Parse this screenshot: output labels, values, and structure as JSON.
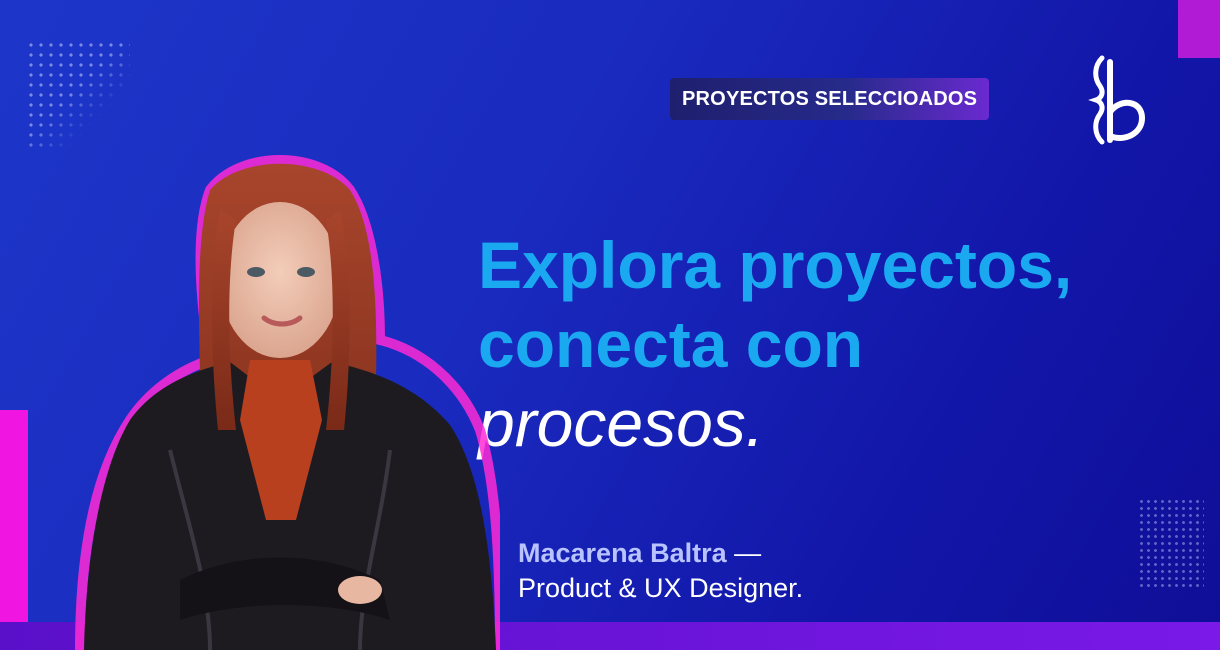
{
  "badge": {
    "label": "PROYECTOS SELECCIOADOS"
  },
  "logo": {
    "icon": "brand-logo-icon",
    "color": "#ffffff"
  },
  "headline": {
    "line1": "Explora proyectos,",
    "line2": "conecta con",
    "line3": "procesos."
  },
  "author": {
    "name": "Macarena Baltra",
    "dash": " —",
    "role": "Product & UX Designer."
  },
  "colors": {
    "background": "#1a2bbf",
    "headline_accent": "#1aa9f0",
    "magenta": "#f015e0",
    "purple_bar": "#6a14d8"
  }
}
